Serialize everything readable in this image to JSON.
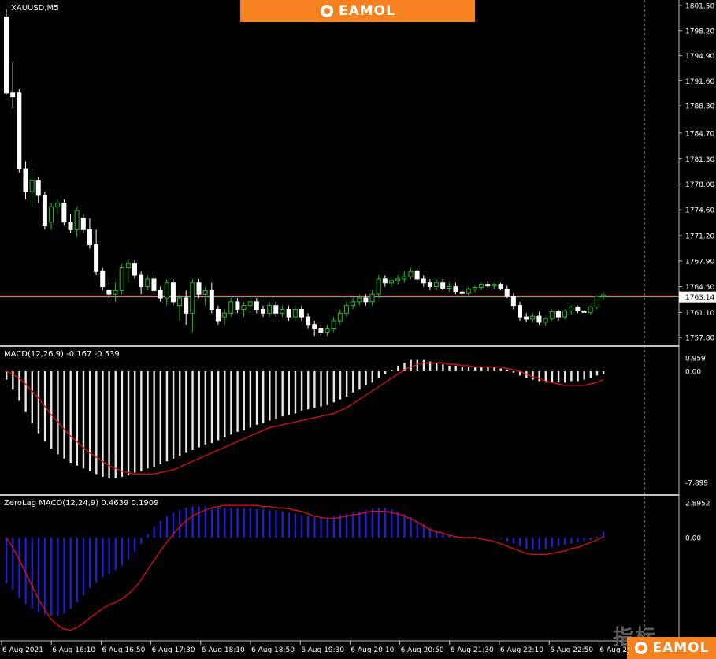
{
  "brand": {
    "name": "EAMOL"
  },
  "watermark": "指标",
  "chart_data": [
    {
      "type": "candlestick",
      "title": "XAUUSD,M5",
      "price_levels": [
        "1801.50",
        "1798.20",
        "1794.90",
        "1791.60",
        "1788.30",
        "1784.70",
        "1781.30",
        "1778.00",
        "1774.60",
        "1771.20",
        "1767.90",
        "1764.50",
        "1761.10",
        "1757.80"
      ],
      "current_price": "1763.14",
      "ylim": [
        1757.4,
        1801.6
      ],
      "time_labels": [
        "6 Aug 2021",
        "6 Aug 16:10",
        "6 Aug 16:50",
        "6 Aug 17:30",
        "6 Aug 18:10",
        "6 Aug 18:50",
        "6 Aug 19:30",
        "6 Aug 20:10",
        "6 Aug 20:50",
        "6 Aug 21:30",
        "6 Aug 22:10",
        "6 Aug 22:50",
        "6 Aug 23:30"
      ],
      "ohlc": [
        [
          1800.0,
          1801.0,
          1789.8,
          1790.0
        ],
        [
          1790.0,
          1794.0,
          1788.0,
          1789.5
        ],
        [
          1790.0,
          1790.5,
          1779.5,
          1780.0
        ],
        [
          1780.0,
          1781.0,
          1776.0,
          1777.0
        ],
        [
          1777.0,
          1780.0,
          1775.0,
          1778.5
        ],
        [
          1778.5,
          1779.0,
          1775.5,
          1776.5
        ],
        [
          1776.5,
          1777.0,
          1772.0,
          1772.5
        ],
        [
          1773.0,
          1775.5,
          1772.0,
          1775.0
        ],
        [
          1775.0,
          1776.0,
          1774.0,
          1775.5
        ],
        [
          1775.5,
          1776.0,
          1772.5,
          1773.0
        ],
        [
          1773.0,
          1774.0,
          1771.5,
          1772.0
        ],
        [
          1772.0,
          1775.0,
          1771.0,
          1774.5
        ],
        [
          1773.5,
          1774.0,
          1771.5,
          1772.0
        ],
        [
          1772.0,
          1773.5,
          1769.5,
          1770.0
        ],
        [
          1770.0,
          1772.0,
          1766.0,
          1766.5
        ],
        [
          1766.5,
          1767.0,
          1764.0,
          1764.5
        ],
        [
          1764.0,
          1765.5,
          1763.0,
          1763.5
        ],
        [
          1763.5,
          1765.0,
          1762.5,
          1764.0
        ],
        [
          1764.0,
          1767.5,
          1763.5,
          1767.0
        ],
        [
          1767.0,
          1768.0,
          1765.0,
          1767.5
        ],
        [
          1767.5,
          1768.0,
          1765.5,
          1766.0
        ],
        [
          1766.0,
          1766.5,
          1763.5,
          1764.5
        ],
        [
          1764.5,
          1766.0,
          1764.0,
          1765.5
        ],
        [
          1765.5,
          1766.0,
          1763.5,
          1764.0
        ],
        [
          1764.0,
          1764.5,
          1762.5,
          1763.0
        ],
        [
          1763.0,
          1765.5,
          1762.0,
          1765.0
        ],
        [
          1765.0,
          1765.5,
          1762.0,
          1762.5
        ],
        [
          1762.0,
          1763.5,
          1760.0,
          1763.0
        ],
        [
          1763.0,
          1764.0,
          1759.5,
          1761.0
        ],
        [
          1761.0,
          1765.5,
          1758.5,
          1765.0
        ],
        [
          1765.0,
          1765.5,
          1763.0,
          1763.5
        ],
        [
          1763.5,
          1764.5,
          1762.0,
          1764.0
        ],
        [
          1764.0,
          1765.0,
          1761.0,
          1761.5
        ],
        [
          1761.5,
          1762.0,
          1759.5,
          1760.0
        ],
        [
          1760.5,
          1761.5,
          1759.5,
          1761.0
        ],
        [
          1761.0,
          1763.0,
          1760.5,
          1762.5
        ],
        [
          1762.5,
          1763.0,
          1761.0,
          1761.5
        ],
        [
          1761.5,
          1762.5,
          1760.5,
          1762.0
        ],
        [
          1762.0,
          1763.0,
          1761.0,
          1762.5
        ],
        [
          1762.5,
          1763.0,
          1761.0,
          1761.5
        ],
        [
          1761.5,
          1762.0,
          1760.5,
          1761.0
        ],
        [
          1761.0,
          1762.5,
          1760.5,
          1762.0
        ],
        [
          1762.0,
          1762.5,
          1760.5,
          1761.0
        ],
        [
          1761.0,
          1762.0,
          1760.5,
          1761.5
        ],
        [
          1761.5,
          1762.0,
          1760.0,
          1760.5
        ],
        [
          1760.5,
          1762.0,
          1760.0,
          1761.5
        ],
        [
          1761.5,
          1762.0,
          1760.0,
          1760.5
        ],
        [
          1760.5,
          1761.0,
          1759.0,
          1759.5
        ],
        [
          1759.5,
          1760.0,
          1758.0,
          1759.0
        ],
        [
          1759.0,
          1759.5,
          1758.0,
          1758.5
        ],
        [
          1758.5,
          1759.5,
          1758.0,
          1759.0
        ],
        [
          1759.0,
          1760.5,
          1758.5,
          1760.0
        ],
        [
          1760.0,
          1761.5,
          1759.5,
          1761.0
        ],
        [
          1761.0,
          1762.5,
          1760.5,
          1762.0
        ],
        [
          1762.0,
          1763.0,
          1761.5,
          1762.5
        ],
        [
          1762.5,
          1763.5,
          1762.0,
          1763.0
        ],
        [
          1763.0,
          1763.5,
          1762.0,
          1762.5
        ],
        [
          1762.5,
          1764.0,
          1762.0,
          1763.5
        ],
        [
          1763.5,
          1766.0,
          1763.0,
          1765.5
        ],
        [
          1765.5,
          1766.0,
          1764.5,
          1765.0
        ],
        [
          1765.0,
          1765.5,
          1764.5,
          1765.3
        ],
        [
          1765.3,
          1766.0,
          1764.8,
          1765.5
        ],
        [
          1765.5,
          1766.5,
          1765.0,
          1765.8
        ],
        [
          1765.8,
          1767.0,
          1765.5,
          1766.5
        ],
        [
          1766.5,
          1767.0,
          1765.0,
          1765.5
        ],
        [
          1765.5,
          1766.0,
          1764.5,
          1765.0
        ],
        [
          1765.0,
          1765.5,
          1764.0,
          1764.5
        ],
        [
          1764.5,
          1765.5,
          1764.0,
          1765.0
        ],
        [
          1765.0,
          1765.5,
          1764.0,
          1764.3
        ],
        [
          1764.3,
          1765.0,
          1763.8,
          1764.5
        ],
        [
          1764.5,
          1765.0,
          1763.5,
          1763.8
        ],
        [
          1763.8,
          1764.2,
          1763.3,
          1763.6
        ],
        [
          1763.6,
          1764.5,
          1763.2,
          1764.2
        ],
        [
          1764.2,
          1764.6,
          1763.7,
          1764.4
        ],
        [
          1764.4,
          1765.0,
          1764.0,
          1764.8
        ],
        [
          1764.8,
          1765.2,
          1764.4,
          1764.6
        ],
        [
          1764.6,
          1765.0,
          1764.2,
          1764.8
        ],
        [
          1764.8,
          1765.0,
          1764.0,
          1764.2
        ],
        [
          1764.2,
          1764.6,
          1763.0,
          1763.2
        ],
        [
          1763.2,
          1763.6,
          1761.5,
          1762.0
        ],
        [
          1762.0,
          1762.5,
          1760.0,
          1760.5
        ],
        [
          1760.5,
          1761.0,
          1759.8,
          1760.2
        ],
        [
          1760.2,
          1761.0,
          1759.8,
          1760.6
        ],
        [
          1760.6,
          1761.2,
          1759.5,
          1759.8
        ],
        [
          1759.8,
          1760.5,
          1759.4,
          1760.3
        ],
        [
          1760.3,
          1761.5,
          1760.0,
          1761.2
        ],
        [
          1761.2,
          1761.5,
          1760.0,
          1760.5
        ],
        [
          1760.5,
          1761.5,
          1760.2,
          1761.3
        ],
        [
          1761.3,
          1762.0,
          1760.8,
          1761.8
        ],
        [
          1761.8,
          1762.0,
          1761.0,
          1761.3
        ],
        [
          1761.3,
          1761.8,
          1760.7,
          1761.1
        ],
        [
          1761.1,
          1762.0,
          1760.8,
          1761.8
        ],
        [
          1761.8,
          1763.4,
          1761.5,
          1763.2
        ],
        [
          1763.2,
          1763.8,
          1762.8,
          1763.4
        ]
      ]
    },
    {
      "type": "bar-line",
      "title": "MACD(12,26,9) -0.167 -0.539",
      "price_levels": [
        "0.959",
        "0.00",
        "-7.899"
      ],
      "ylim": [
        -8.4,
        1.4
      ],
      "series": [
        {
          "name": "MACD",
          "values": [
            -0.6,
            -1.3,
            -2.1,
            -2.9,
            -3.7,
            -4.4,
            -5.0,
            -5.5,
            -5.9,
            -6.2,
            -6.5,
            -6.7,
            -6.9,
            -7.1,
            -7.3,
            -7.5,
            -7.6,
            -7.6,
            -7.5,
            -7.4,
            -7.2,
            -7.1,
            -6.9,
            -6.8,
            -6.6,
            -6.4,
            -6.2,
            -6.0,
            -5.8,
            -5.6,
            -5.4,
            -5.2,
            -5.1,
            -4.9,
            -4.7,
            -4.5,
            -4.3,
            -4.2,
            -4.0,
            -3.8,
            -3.7,
            -3.5,
            -3.4,
            -3.2,
            -3.1,
            -3.0,
            -2.8,
            -2.7,
            -2.6,
            -2.5,
            -2.4,
            -2.2,
            -2.0,
            -1.8,
            -1.5,
            -1.3,
            -1.0,
            -0.8,
            -0.5,
            -0.2,
            0.1,
            0.4,
            0.6,
            0.8,
            0.8,
            0.8,
            0.7,
            0.6,
            0.5,
            0.4,
            0.4,
            0.3,
            0.3,
            0.3,
            0.3,
            0.3,
            0.3,
            0.2,
            0.1,
            -0.1,
            -0.3,
            -0.5,
            -0.6,
            -0.7,
            -0.8,
            -0.8,
            -0.8,
            -0.8,
            -0.7,
            -0.7,
            -0.6,
            -0.5,
            -0.3,
            -0.2
          ]
        },
        {
          "name": "Signal",
          "values": [
            0.0,
            -0.2,
            -0.5,
            -0.9,
            -1.4,
            -1.9,
            -2.5,
            -3.1,
            -3.6,
            -4.1,
            -4.6,
            -5.0,
            -5.4,
            -5.8,
            -6.1,
            -6.4,
            -6.7,
            -6.9,
            -7.1,
            -7.2,
            -7.3,
            -7.3,
            -7.3,
            -7.3,
            -7.2,
            -7.1,
            -7.0,
            -6.8,
            -6.6,
            -6.4,
            -6.2,
            -6.0,
            -5.8,
            -5.6,
            -5.4,
            -5.2,
            -5.0,
            -4.8,
            -4.6,
            -4.4,
            -4.2,
            -4.0,
            -3.9,
            -3.8,
            -3.7,
            -3.6,
            -3.5,
            -3.4,
            -3.3,
            -3.2,
            -3.1,
            -3.0,
            -2.8,
            -2.6,
            -2.3,
            -2.0,
            -1.7,
            -1.4,
            -1.1,
            -0.8,
            -0.5,
            -0.2,
            0.1,
            0.3,
            0.5,
            0.6,
            0.6,
            0.6,
            0.6,
            0.5,
            0.5,
            0.4,
            0.4,
            0.3,
            0.3,
            0.3,
            0.3,
            0.3,
            0.2,
            0.1,
            0.0,
            -0.2,
            -0.4,
            -0.5,
            -0.7,
            -0.8,
            -0.9,
            -1.0,
            -1.0,
            -1.0,
            -1.0,
            -0.9,
            -0.8,
            -0.6
          ]
        }
      ]
    },
    {
      "type": "bar-line",
      "title": "ZeroLag MACD(12,24,9) 0.4639 0.1909",
      "price_levels": [
        "2.8952",
        "0.00"
      ],
      "ylim": [
        -8.2,
        3.1
      ],
      "series": [
        {
          "name": "ZeroLag MACD",
          "values": [
            -3.8,
            -4.4,
            -5.0,
            -5.5,
            -5.9,
            -6.2,
            -6.4,
            -6.5,
            -6.5,
            -6.3,
            -5.9,
            -5.4,
            -4.8,
            -4.2,
            -3.7,
            -3.3,
            -3.0,
            -2.7,
            -2.3,
            -1.8,
            -1.2,
            -0.5,
            0.3,
            0.9,
            1.4,
            1.8,
            2.1,
            2.3,
            2.5,
            2.6,
            2.6,
            2.6,
            2.5,
            2.5,
            2.5,
            2.5,
            2.5,
            2.5,
            2.5,
            2.4,
            2.4,
            2.3,
            2.3,
            2.2,
            2.1,
            2.0,
            1.9,
            1.8,
            1.7,
            1.7,
            1.7,
            1.8,
            1.9,
            2.0,
            2.1,
            2.2,
            2.3,
            2.4,
            2.5,
            2.5,
            2.4,
            2.2,
            2.0,
            1.7,
            1.4,
            1.1,
            0.8,
            0.6,
            0.4,
            0.2,
            0.1,
            0.1,
            0.1,
            0.1,
            0.0,
            0.0,
            0.0,
            -0.1,
            -0.3,
            -0.5,
            -0.7,
            -0.9,
            -1.0,
            -1.0,
            -0.9,
            -0.8,
            -0.7,
            -0.6,
            -0.5,
            -0.4,
            -0.3,
            -0.2,
            0.1,
            0.5
          ]
        },
        {
          "name": "Signal",
          "values": [
            0.0,
            -0.8,
            -1.8,
            -2.9,
            -4.0,
            -5.1,
            -6.0,
            -6.8,
            -7.3,
            -7.6,
            -7.7,
            -7.5,
            -7.1,
            -6.7,
            -6.3,
            -5.9,
            -5.6,
            -5.4,
            -5.1,
            -4.7,
            -4.2,
            -3.5,
            -2.7,
            -1.9,
            -1.1,
            -0.4,
            0.3,
            0.9,
            1.4,
            1.8,
            2.1,
            2.3,
            2.5,
            2.6,
            2.7,
            2.7,
            2.7,
            2.7,
            2.7,
            2.7,
            2.6,
            2.6,
            2.5,
            2.5,
            2.4,
            2.3,
            2.2,
            2.0,
            1.8,
            1.7,
            1.6,
            1.6,
            1.7,
            1.8,
            1.9,
            2.0,
            2.1,
            2.2,
            2.2,
            2.2,
            2.1,
            2.0,
            1.8,
            1.6,
            1.3,
            1.0,
            0.7,
            0.5,
            0.4,
            0.2,
            0.1,
            0.0,
            0.0,
            0.0,
            -0.1,
            -0.2,
            -0.3,
            -0.5,
            -0.7,
            -0.9,
            -1.1,
            -1.3,
            -1.4,
            -1.4,
            -1.4,
            -1.3,
            -1.2,
            -1.1,
            -0.9,
            -0.8,
            -0.6,
            -0.4,
            -0.2,
            0.1
          ]
        }
      ]
    }
  ],
  "colors": {
    "background": "#000000",
    "candle_up": "#20c020",
    "candle_down": "#ffffff",
    "signal": "#e01010",
    "zl_hist": "#1e1ed2",
    "grid": "#c0c0c0",
    "price_line": "#ff2020"
  }
}
